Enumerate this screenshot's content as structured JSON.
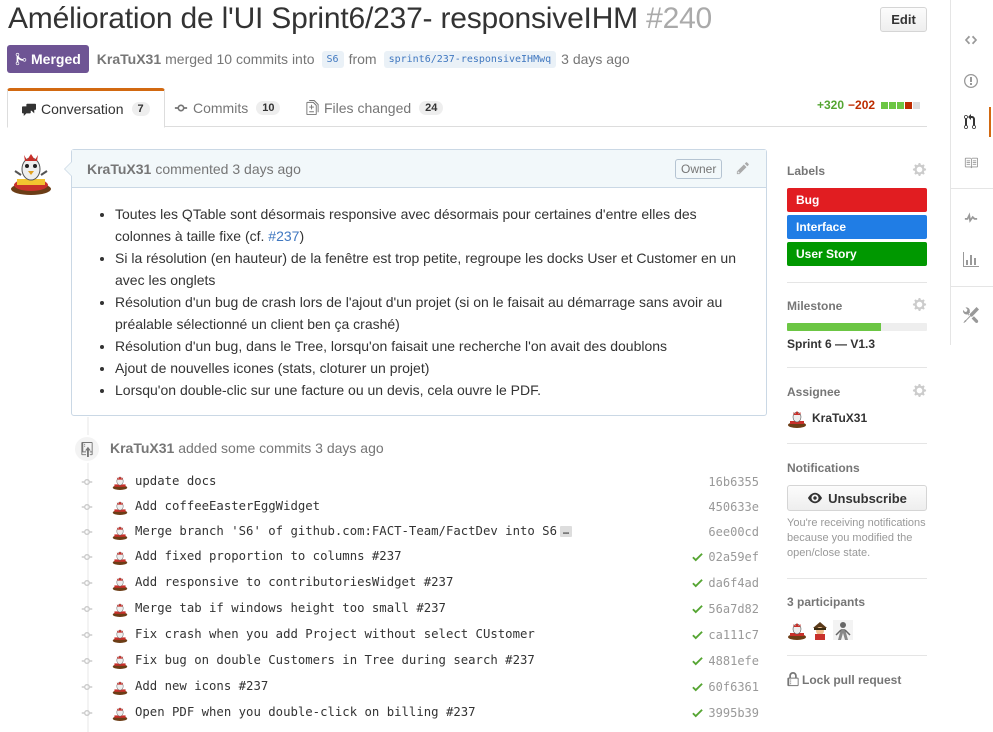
{
  "pr": {
    "title": "Amélioration de l'UI Sprint6/237- responsiveIHM",
    "number": "#240",
    "edit_label": "Edit",
    "state_label": "Merged",
    "author": "KraTuX31",
    "merged_text": "merged 10 commits into",
    "base_branch": "S6",
    "from_text": "from",
    "head_branch": "sprint6/237-responsiveIHMwq",
    "time_ago": "3 days ago"
  },
  "tabs": [
    {
      "label": "Conversation",
      "count": "7"
    },
    {
      "label": "Commits",
      "count": "10"
    },
    {
      "label": "Files changed",
      "count": "24"
    }
  ],
  "diffstat": {
    "additions": "+320",
    "deletions": "−202"
  },
  "comment": {
    "author": "KraTuX31",
    "action": "commented 3 days ago",
    "role": "Owner",
    "items": [
      {
        "text": "Toutes les QTable sont désormais responsive avec désormais pour certaines d'entre elles des colonnes à taille fixe (cf. ",
        "link": "#237",
        "after": ")"
      },
      {
        "text": "Si la résolution (en hauteur) de la fenêtre est trop petite, regroupe les docks User et Customer en un avec les onglets"
      },
      {
        "text": "Résolution d'un bug de crash lors de l'ajout d'un projet (si on le faisait au démarrage sans avoir au préalable sélectionné un client ben ça crashé)"
      },
      {
        "text": "Résolution d'un bug, dans le Tree, lorsqu'on faisait une recherche l'on avait des doublons"
      },
      {
        "text": "Ajout de nouvelles icones (stats, cloturer un projet)"
      },
      {
        "text": "Lorsqu'on double-clic sur une facture ou un devis, cela ouvre le PDF."
      }
    ]
  },
  "commits_event": {
    "author": "KraTuX31",
    "action": "added some commits 3 days ago"
  },
  "commits": [
    {
      "message": "update docs",
      "sha": "16b6355",
      "status": ""
    },
    {
      "message": "Add coffeeEasterEggWidget",
      "sha": "450633e",
      "status": ""
    },
    {
      "message": "Merge branch 'S6' of github.com:FACT-Team/FactDev into S6",
      "sha": "6ee00cd",
      "status": "",
      "ellipsis": "…"
    },
    {
      "message": "Add fixed proportion to columns #237",
      "sha": "02a59ef",
      "status": "success"
    },
    {
      "message": "Add responsive to contributoriesWidget #237",
      "sha": "da6f4ad",
      "status": "success"
    },
    {
      "message": "Merge tab if windows height too small #237",
      "sha": "56a7d82",
      "status": "success"
    },
    {
      "message": "Fix crash when you add Project without select CUstomer",
      "sha": "ca111c7",
      "status": "success"
    },
    {
      "message": "Fix bug on double Customers in Tree during search #237",
      "sha": "4881efe",
      "status": "success"
    },
    {
      "message": "Add new icons #237",
      "sha": "60f6361",
      "status": "success"
    },
    {
      "message": "Open PDF when you double-click on billing #237",
      "sha": "3995b39",
      "status": "success"
    }
  ],
  "sidebar": {
    "labels_title": "Labels",
    "labels": [
      {
        "name": "Bug",
        "color": "#e11d21"
      },
      {
        "name": "Interface",
        "color": "#207de5"
      },
      {
        "name": "User Story",
        "color": "#009800"
      }
    ],
    "milestone_title": "Milestone",
    "milestone_progress": 0.67,
    "milestone_name": "Sprint 6 — V1.3",
    "assignee_title": "Assignee",
    "assignee_name": "KraTuX31",
    "notifications_title": "Notifications",
    "unsubscribe_label": "Unsubscribe",
    "notifications_text": "You're receiving notifications because you modified the open/close state.",
    "participants_title": "3 participants",
    "lock_label": "Lock pull request"
  },
  "colors": {
    "merged": "#6e5494",
    "accent": "#d26911",
    "link": "#4078c0",
    "success": "#55a532",
    "danger": "#bd2c00"
  }
}
